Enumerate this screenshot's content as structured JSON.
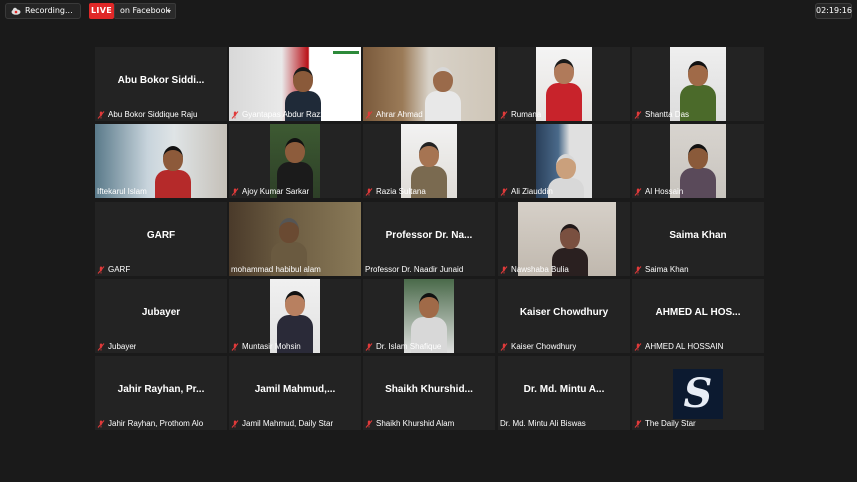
{
  "topbar": {
    "recording_label": "Recording...",
    "live_label": "LIVE",
    "stream_target": "on Facebook",
    "timer": "02:19:16"
  },
  "tiles": [
    {
      "center": "Abu Bokor Siddi...",
      "label": "Abu Bokor Siddique Raju",
      "muted": true
    },
    {
      "center": "",
      "label": "Gyantapas Abdur Razzaq Fou",
      "muted": true
    },
    {
      "center": "",
      "label": "Ahrar Ahmad",
      "muted": true
    },
    {
      "center": "",
      "label": "Rumana",
      "muted": true
    },
    {
      "center": "",
      "label": "Shantta Das",
      "muted": true
    },
    {
      "center": "",
      "label": "Iftekarul Islam",
      "muted": false
    },
    {
      "center": "",
      "label": "Ajoy Kumar Sarkar",
      "muted": true
    },
    {
      "center": "",
      "label": "Razia Sultana",
      "muted": true
    },
    {
      "center": "",
      "label": "Ali Ziauddin",
      "muted": true
    },
    {
      "center": "",
      "label": "Al Hossain",
      "muted": true
    },
    {
      "center": "GARF",
      "label": "GARF",
      "muted": true
    },
    {
      "center": "",
      "label": "mohammad habibul alam",
      "muted": false
    },
    {
      "center": "Professor Dr. Na...",
      "label": "Professor Dr. Naadir Junaid",
      "muted": false
    },
    {
      "center": "",
      "label": "Nawshaba Bulia",
      "muted": true
    },
    {
      "center": "Saima Khan",
      "label": "Saima Khan",
      "muted": true
    },
    {
      "center": "Jubayer",
      "label": "Jubayer",
      "muted": true
    },
    {
      "center": "",
      "label": "Muntasir Mohsin",
      "muted": true
    },
    {
      "center": "",
      "label": "Dr. Islam Shafique",
      "muted": true
    },
    {
      "center": "Kaiser Chowdhury",
      "label": "Kaiser Chowdhury",
      "muted": true
    },
    {
      "center": "AHMED AL HOS...",
      "label": "AHMED AL HOSSAIN",
      "muted": true
    },
    {
      "center": "Jahir Rayhan, Pr...",
      "label": "Jahir Rayhan, Prothom Alo",
      "muted": true
    },
    {
      "center": "Jamil Mahmud,...",
      "label": "Jamil Mahmud, Daily Star",
      "muted": true
    },
    {
      "center": "Shaikh Khurshid...",
      "label": "Shaikh Khurshid Alam",
      "muted": true
    },
    {
      "center": "Dr. Md. Mintu A...",
      "label": "Dr. Md. Mintu Ali Biswas",
      "muted": false
    },
    {
      "center": "",
      "label": "The Daily Star",
      "muted": true,
      "logo_letter": "S"
    }
  ],
  "colors": {
    "background": "#1a1a1a",
    "tile": "#232323",
    "live_red": "#e02828",
    "active_speaker": "#c9e04a",
    "muted_icon": "#e03a3a"
  }
}
